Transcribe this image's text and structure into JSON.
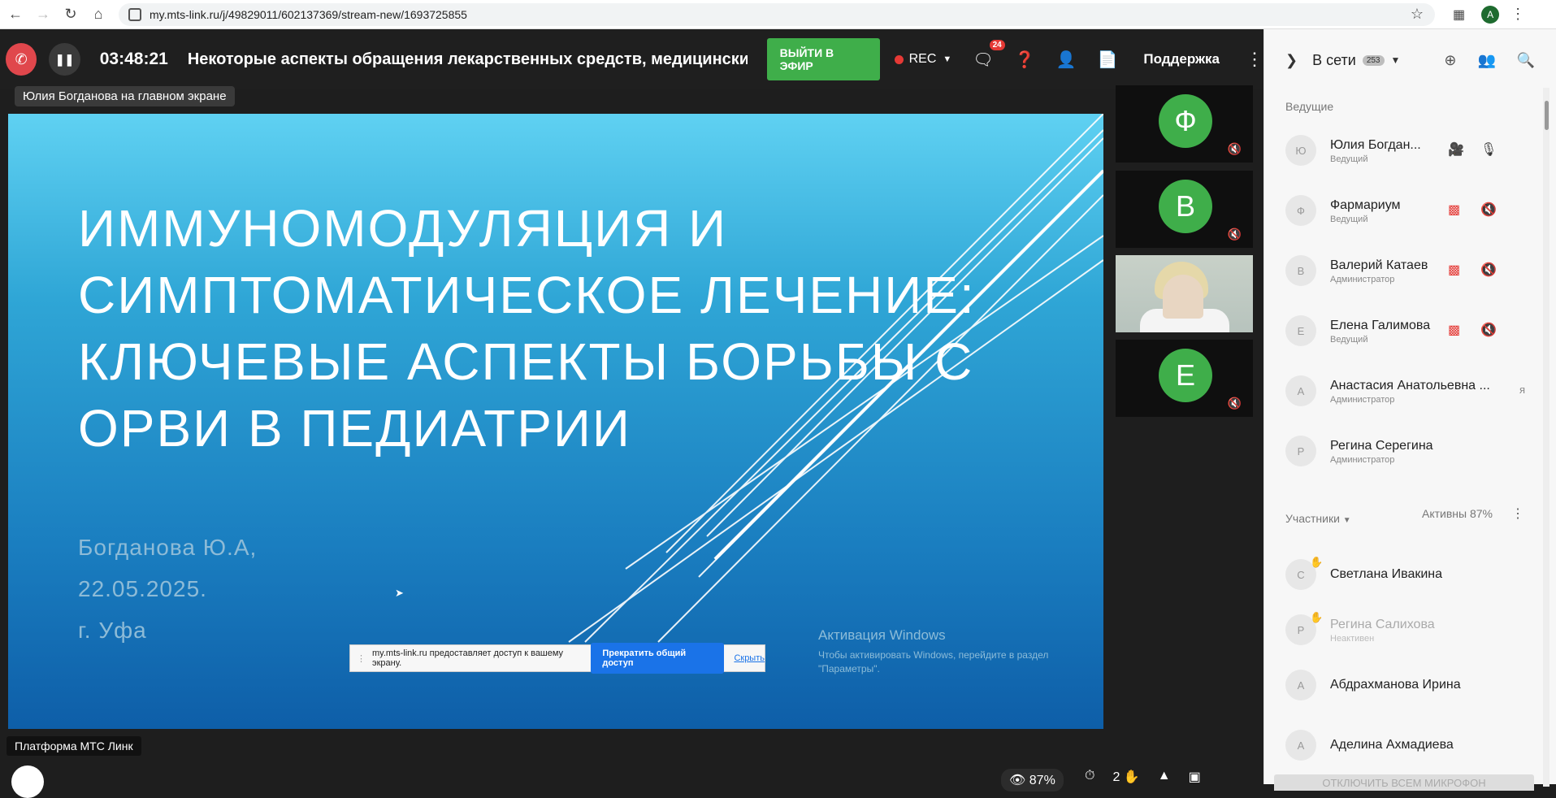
{
  "browser": {
    "url": "my.mts-link.ru/j/49829011/602137369/stream-new/1693725855",
    "profile_initial": "A"
  },
  "toolbar": {
    "timer": "03:48:21",
    "event_title": "Некоторые аспекты обращения лекарственных средств, медицинских из,",
    "on_air_label": "ВЫЙТИ В ЭФИР",
    "rec_label": "REC",
    "chat_count": "24",
    "support_label": "Поддержка"
  },
  "stage": {
    "screen_tag": "Юлия Богданова на главном экране",
    "slide": {
      "title": "Иммуномодуляция и симптоматическое лечение: ключевые аспекты борьбы с ОРВИ в педиатрии",
      "author": "Богданова Ю.А,",
      "date": "22.05.2025.",
      "city": "г. Уфа"
    },
    "windows_activation": {
      "title": "Активация Windows",
      "text": "Чтобы активировать Windows, перейдите в раздел \"Параметры\"."
    },
    "share_bar": {
      "text": "my.mts-link.ru предоставляет доступ к вашему экрану.",
      "stop_label": "Прекратить общий доступ",
      "hide_label": "Скрыть"
    }
  },
  "tiles": [
    {
      "initial": "Ф"
    },
    {
      "initial": "В"
    },
    {
      "initial": ""
    },
    {
      "initial": "Е"
    }
  ],
  "footer": {
    "platform_label": "Платформа МТС Линк",
    "viewers_percent": "87%",
    "raised_hands": "2"
  },
  "panel": {
    "title": "В сети",
    "online_count": "253",
    "hosts_label": "Ведущие",
    "participants_label": "Участники",
    "active_label": "Активны 87%",
    "mute_all_label": "ОТКЛЮЧИТЬ ВСЕМ МИКРОФОН",
    "hosts": [
      {
        "initial": "Ю",
        "name": "Юлия Богдан...",
        "role": "Ведущий"
      },
      {
        "initial": "Ф",
        "name": "Фармариум",
        "role": "Ведущий"
      },
      {
        "initial": "В",
        "name": "Валерий Катаев",
        "role": "Администратор"
      },
      {
        "initial": "Е",
        "name": "Елена Галимова",
        "role": "Ведущий"
      },
      {
        "initial": "А",
        "name": "Анастасия Анатольевна ...",
        "role": "Администратор",
        "extra": "я"
      },
      {
        "initial": "Р",
        "name": "Регина Серегина",
        "role": "Администратор"
      }
    ],
    "participants": [
      {
        "initial": "С",
        "name": "Светлана Ивакина",
        "role": ""
      },
      {
        "initial": "Р",
        "name": "Регина Салихова",
        "role": "Неактивен"
      },
      {
        "initial": "А",
        "name": "Абдрахманова Ирина",
        "role": ""
      },
      {
        "initial": "А",
        "name": "Аделина Ахмадиева",
        "role": ""
      }
    ]
  }
}
